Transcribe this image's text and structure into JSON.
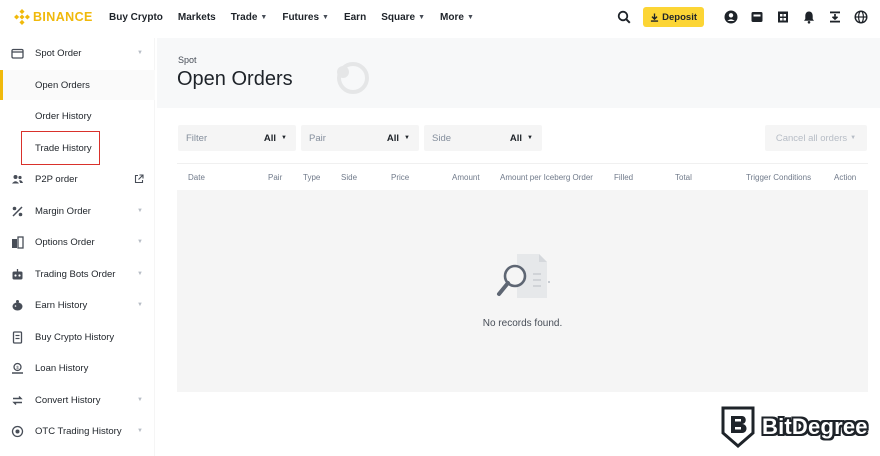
{
  "brand": {
    "name": "BINANCE",
    "color": "#f0b90b"
  },
  "nav": [
    {
      "label": "Buy Crypto",
      "dropdown": false
    },
    {
      "label": "Markets",
      "dropdown": false
    },
    {
      "label": "Trade",
      "dropdown": true
    },
    {
      "label": "Futures",
      "dropdown": true
    },
    {
      "label": "Earn",
      "dropdown": false
    },
    {
      "label": "Square",
      "dropdown": true
    },
    {
      "label": "More",
      "dropdown": true
    }
  ],
  "header_actions": {
    "deposit_label": "Deposit",
    "icons": [
      "search-icon",
      "user-icon",
      "wallet-icon",
      "orders-icon",
      "bell-icon",
      "download-icon",
      "globe-icon"
    ]
  },
  "sidebar": {
    "items": [
      {
        "label": "Spot Order",
        "icon": "wallet-icon",
        "expanded": true
      },
      {
        "label": "Open Orders",
        "sub": true,
        "active": true
      },
      {
        "label": "Order History",
        "sub": true
      },
      {
        "label": "Trade History",
        "sub": true,
        "highlighted": true
      },
      {
        "label": "P2P order",
        "icon": "users-icon",
        "external": true
      },
      {
        "label": "Margin Order",
        "icon": "percent-icon"
      },
      {
        "label": "Options Order",
        "icon": "options-icon"
      },
      {
        "label": "Trading Bots Order",
        "icon": "bot-icon"
      },
      {
        "label": "Earn History",
        "icon": "piggy-bank-icon"
      },
      {
        "label": "Buy Crypto History",
        "icon": "receipt-icon"
      },
      {
        "label": "Loan History",
        "icon": "loan-icon"
      },
      {
        "label": "Convert History",
        "icon": "convert-icon"
      },
      {
        "label": "OTC Trading History",
        "icon": "otc-icon"
      }
    ]
  },
  "main": {
    "breadcrumb": "Spot",
    "title": "Open Orders",
    "filters": [
      {
        "label": "Filter",
        "value": "All"
      },
      {
        "label": "Pair",
        "value": "All"
      },
      {
        "label": "Side",
        "value": "All"
      }
    ],
    "cancel_all_label": "Cancel all orders",
    "columns": [
      "Date",
      "Pair",
      "Type",
      "Side",
      "Price",
      "Amount",
      "Amount per Iceberg Order",
      "Filled",
      "Total",
      "Trigger Conditions",
      "Action"
    ],
    "empty_text": "No records found."
  },
  "watermark": {
    "text": "BitDegree"
  },
  "colors": {
    "accent": "#fcd535",
    "highlight_box": "#d9312b",
    "table_bg": "#f5f5f5"
  }
}
